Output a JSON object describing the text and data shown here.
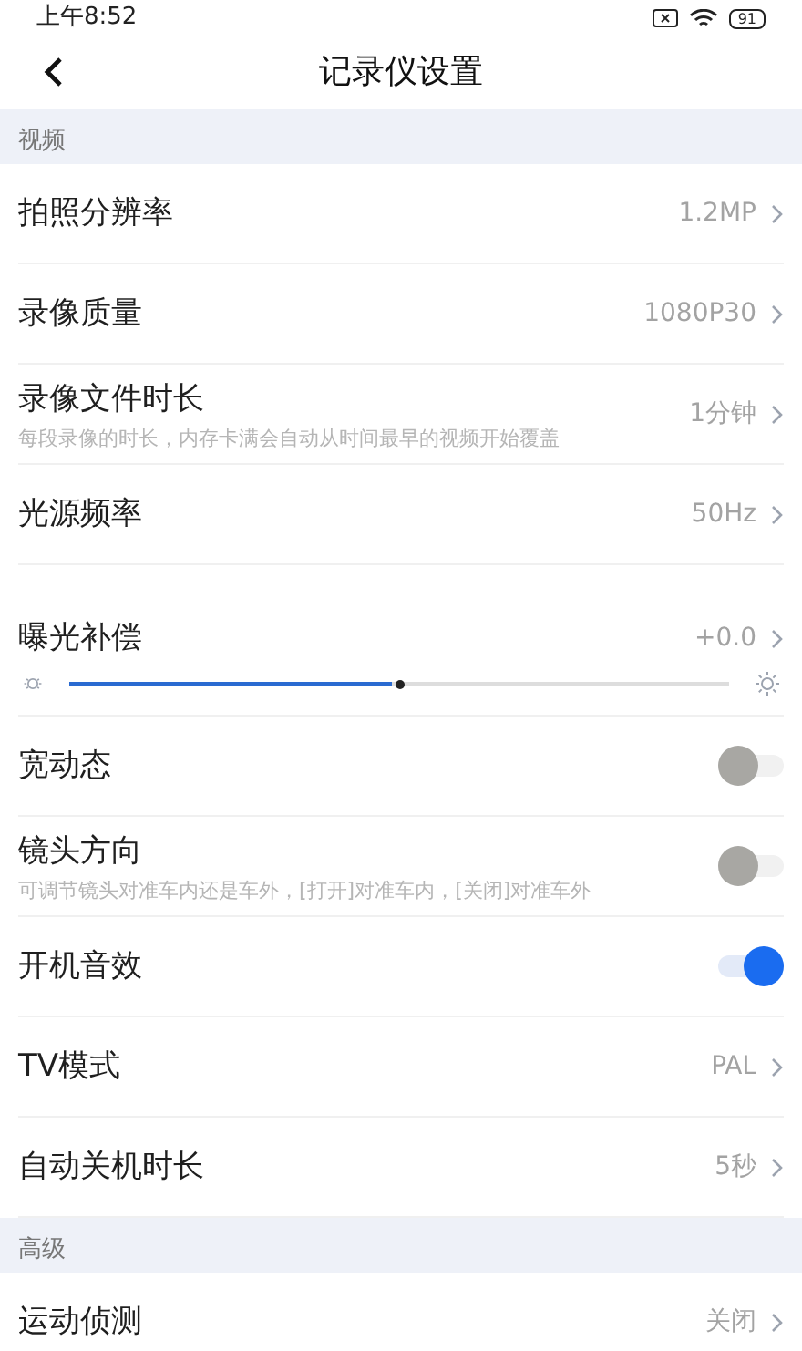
{
  "status_bar": {
    "time": "上午8:52",
    "battery": "91"
  },
  "header": {
    "title": "记录仪设置"
  },
  "sections": [
    {
      "title": "视频",
      "items": [
        {
          "kind": "value",
          "label": "拍照分辨率",
          "value": "1.2MP"
        },
        {
          "kind": "value",
          "label": "录像质量",
          "value": "1080P30"
        },
        {
          "kind": "value",
          "label": "录像文件时长",
          "description": "每段录像的时长，内存卡满会自动从时间最早的视频开始覆盖",
          "value": "1分钟"
        },
        {
          "kind": "value",
          "label": "光源频率",
          "value": "50Hz"
        },
        {
          "kind": "slider",
          "label": "曝光补偿",
          "value": "+0.0",
          "level": 0.5
        },
        {
          "kind": "toggle",
          "label": "宽动态",
          "on": false
        },
        {
          "kind": "toggle",
          "label": "镜头方向",
          "description": "可调节镜头对准车内还是车外，[打开]对准车内，[关闭]对准车外",
          "on": false
        },
        {
          "kind": "toggle",
          "label": "开机音效",
          "on": true
        },
        {
          "kind": "value",
          "label": "TV模式",
          "value": "PAL"
        },
        {
          "kind": "value",
          "label": "自动关机时长",
          "value": "5秒"
        }
      ]
    },
    {
      "title": "高级",
      "items": [
        {
          "kind": "value",
          "label": "运动侦测",
          "value": "关闭"
        }
      ]
    }
  ]
}
